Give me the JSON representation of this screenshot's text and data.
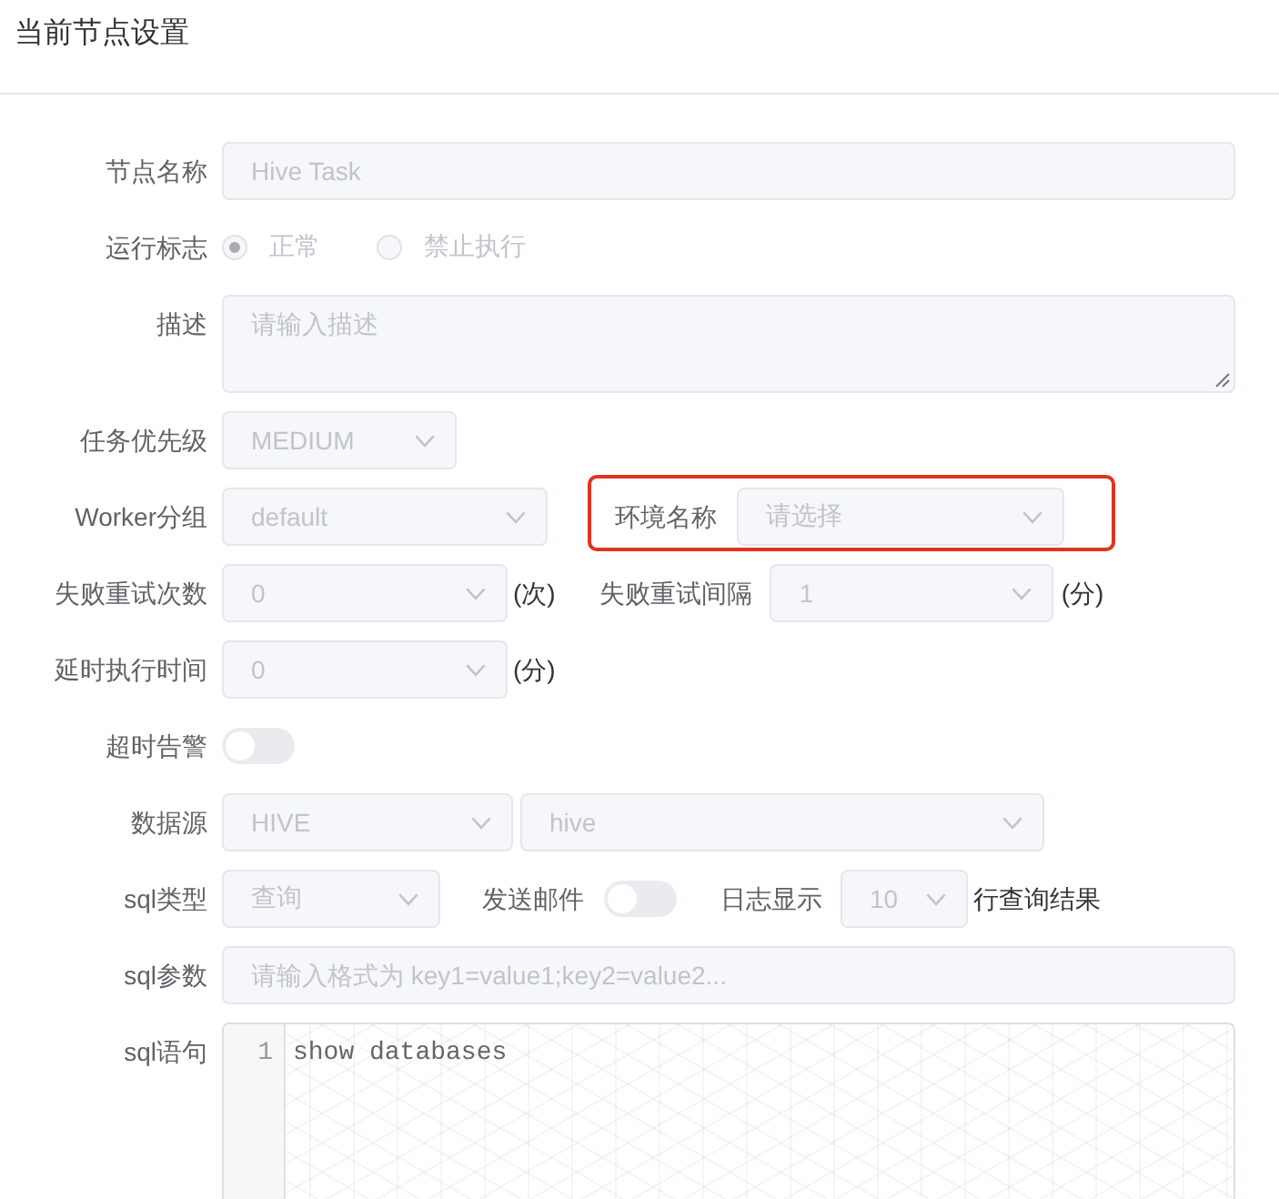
{
  "header": {
    "title": "当前节点设置"
  },
  "form": {
    "disabled": true,
    "node_name": {
      "label": "节点名称",
      "value": "Hive Task"
    },
    "run_flag": {
      "label": "运行标志",
      "options": [
        {
          "label": "正常",
          "selected": true
        },
        {
          "label": "禁止执行",
          "selected": false
        }
      ]
    },
    "description": {
      "label": "描述",
      "placeholder": "请输入描述"
    },
    "task_priority": {
      "label": "任务优先级",
      "value": "MEDIUM"
    },
    "worker_group": {
      "label": "Worker分组",
      "value": "default"
    },
    "environment": {
      "label": "环境名称",
      "placeholder": "请选择",
      "highlighted": true
    },
    "retry_times": {
      "label": "失败重试次数",
      "value": "0",
      "unit": "(次)"
    },
    "retry_interval": {
      "label": "失败重试间隔",
      "value": "1",
      "unit": "(分)"
    },
    "delay_time": {
      "label": "延时执行时间",
      "value": "0",
      "unit": "(分)"
    },
    "timeout_alert": {
      "label": "超时告警",
      "on": false
    },
    "datasource": {
      "label": "数据源",
      "source_type": "HIVE",
      "source_name": "hive"
    },
    "sql_type": {
      "label": "sql类型",
      "value": "查询"
    },
    "send_email": {
      "label": "发送邮件",
      "on": false
    },
    "log_display": {
      "label": "日志显示",
      "value": "10",
      "suffix": "行查询结果"
    },
    "sql_params": {
      "label": "sql参数",
      "placeholder": "请输入格式为 key1=value1;key2=value2..."
    },
    "sql_statement": {
      "label": "sql语句",
      "lines": [
        {
          "number": "1",
          "code": "show databases"
        }
      ]
    }
  }
}
